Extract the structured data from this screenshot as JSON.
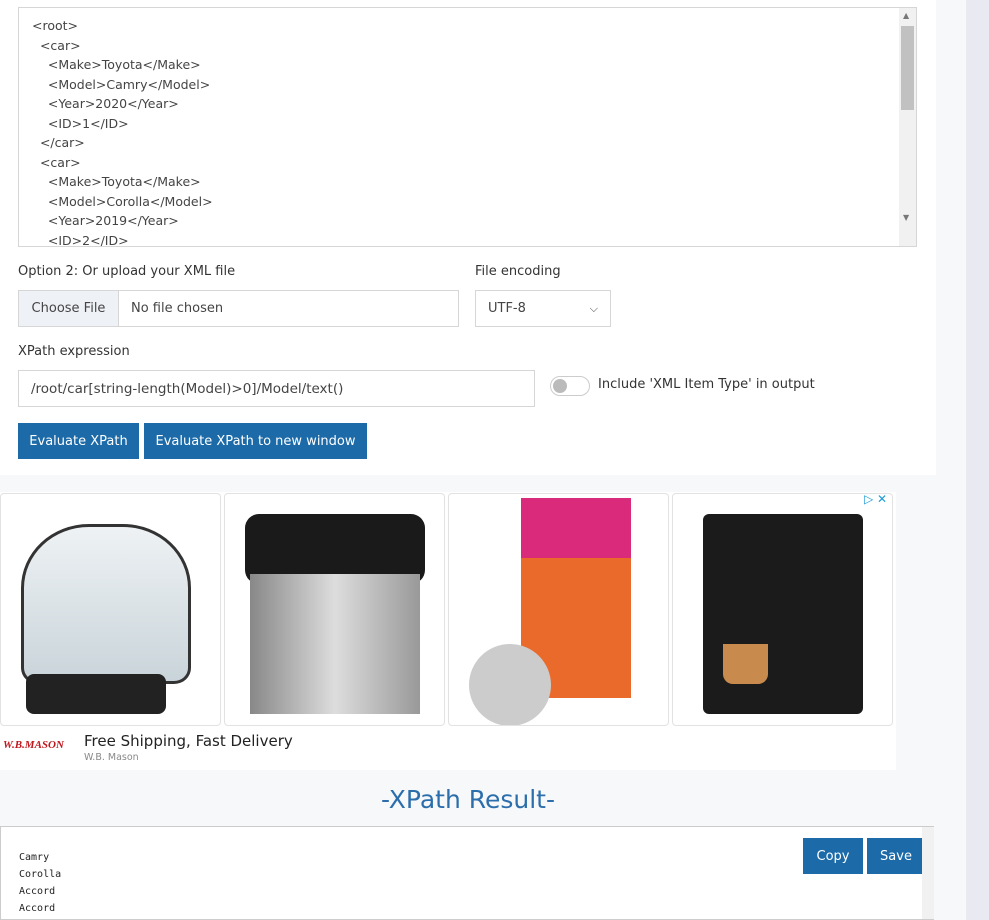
{
  "xml_input": {
    "lines": [
      "<root>",
      "  <car>",
      "    <Make>Toyota</Make>",
      "    <Model>Camry</Model>",
      "    <Year>2020</Year>",
      "    <ID>1</ID>",
      "  </car>",
      "  <car>",
      "    <Make>Toyota</Make>",
      "    <Model>Corolla</Model>",
      "    <Year>2019</Year>",
      "    <ID>2</ID>"
    ]
  },
  "upload": {
    "label": "Option 2: Or upload your XML file",
    "choose": "Choose File",
    "status": "No file chosen"
  },
  "encoding": {
    "label": "File encoding",
    "value": "UTF-8"
  },
  "xpath": {
    "label": "XPath expression",
    "value": "/root/car[string-length(Model)>0]/Model/text()"
  },
  "toggle": {
    "label": "Include 'XML Item Type' in output",
    "on": false
  },
  "buttons": {
    "evaluate": "Evaluate XPath",
    "evaluate_new": "Evaluate XPath to new window",
    "copy": "Copy",
    "save": "Save"
  },
  "ad": {
    "headline": "Free Shipping, Fast Delivery",
    "advertiser": "W.B. Mason",
    "logo": "W.B.MASON"
  },
  "result": {
    "title": "-XPath Result-",
    "lines": [
      "Camry",
      "Corolla",
      "Accord",
      "Accord"
    ]
  }
}
